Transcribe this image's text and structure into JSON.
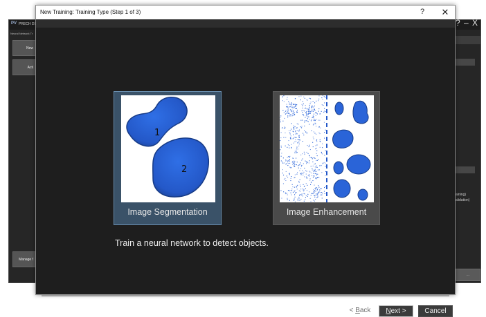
{
  "background_app": {
    "logo": "PV",
    "title": "PRECH DS",
    "subtitle": "Neural Network Tr",
    "controls": [
      "?",
      "–",
      "X"
    ],
    "left_buttons": [
      "New",
      "Acti"
    ],
    "bottom_button": "Manage f",
    "right_text_1": "aining)",
    "right_text_2": "alidation)",
    "right_button": "..."
  },
  "dialog": {
    "title": "New Training: Training Type (Step 1 of 3)",
    "help": "?",
    "close": "✕",
    "options": [
      {
        "label": "Image Segmentation",
        "selected": true,
        "region_labels": [
          "1",
          "2"
        ]
      },
      {
        "label": "Image Enhancement",
        "selected": false
      }
    ],
    "description": "Train a neural network to detect objects.",
    "buttons": {
      "back": {
        "pre": "< ",
        "key": "B",
        "post": "ack"
      },
      "next": {
        "key": "N",
        "post": "ext >"
      },
      "cancel": "Cancel"
    }
  },
  "colors": {
    "accent_selected": "#3a5268",
    "blob_blue": "#2a64d8",
    "dialog_bg": "#1e1e1e"
  }
}
